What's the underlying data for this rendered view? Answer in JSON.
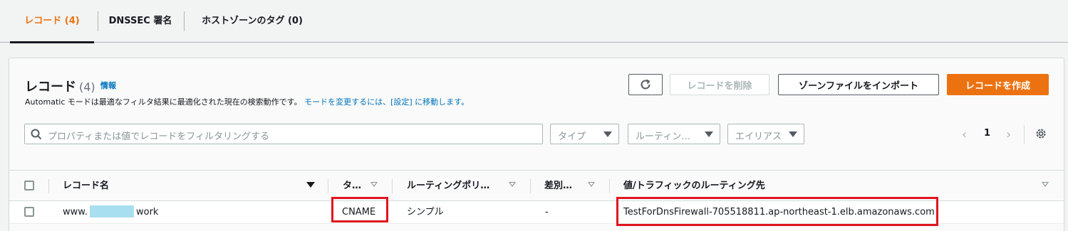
{
  "tabs": [
    {
      "label": "レコード (4)",
      "active": true
    },
    {
      "label": "DNSSEC 署名",
      "active": false
    },
    {
      "label": "ホストゾーンのタグ (0)",
      "active": false
    }
  ],
  "header": {
    "title": "レコード",
    "count": "(4)",
    "info_link": "情報",
    "description": "Automatic モードは最適なフィルタ結果に最適化された現在の検索動作です。",
    "description_link": "モードを変更するには、[設定] に移動します。"
  },
  "actions": {
    "refresh_icon": "refresh-icon",
    "delete_label": "レコードを削除",
    "import_label": "ゾーンファイルをインポート",
    "create_label": "レコードを作成"
  },
  "filters": {
    "search_placeholder": "プロパティまたは値でレコードをフィルタリングする",
    "type_select": "タイプ",
    "routing_select": "ルーティン…",
    "alias_select": "エイリアス"
  },
  "pagination": {
    "current_page": "1",
    "prev_icon": "chevron-left-icon",
    "next_icon": "chevron-right-icon"
  },
  "table": {
    "columns": [
      "レコード名",
      "タ…",
      "ルーティングポリ…",
      "差別…",
      "値/トラフィックのルーティング先"
    ],
    "rows": [
      {
        "name_prefix": "www.",
        "name_suffix": "work",
        "type": "CNAME",
        "routing_policy": "シンプル",
        "differentiator": "-",
        "value": "TestForDnsFirewall-705518811.ap-northeast-1.elb.amazonaws.com"
      }
    ]
  },
  "colors": {
    "accent": "#ec7211",
    "link": "#0073bb",
    "highlight": "#e0151f"
  }
}
